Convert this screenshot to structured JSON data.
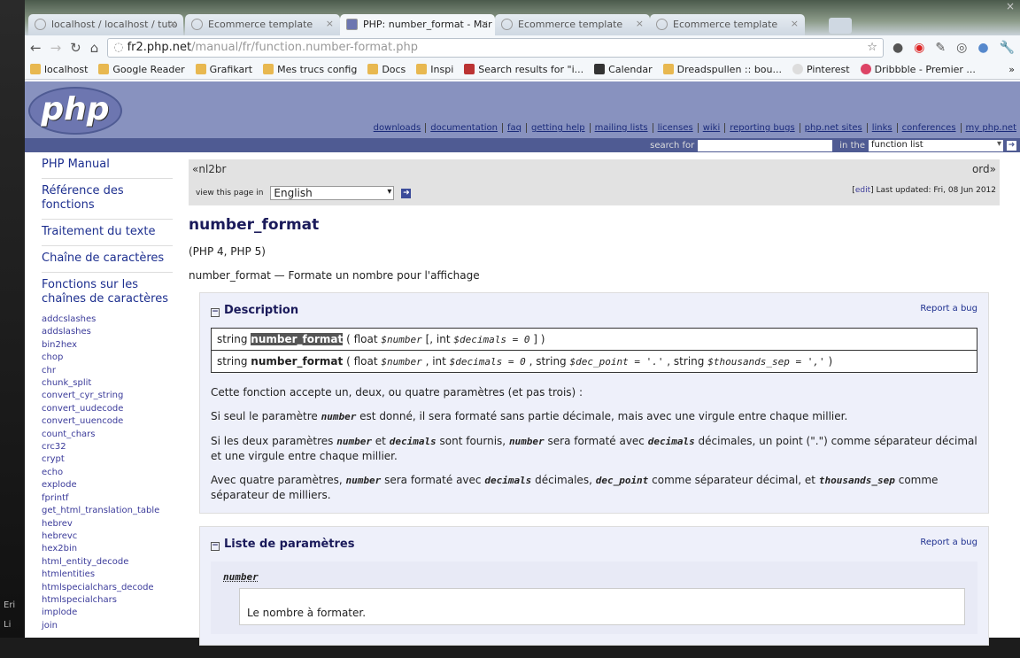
{
  "desktop": {
    "labels": [
      "Eri",
      "Li"
    ]
  },
  "browser": {
    "tabs": [
      {
        "title": "localhost / localhost / tuto"
      },
      {
        "title": "Ecommerce template"
      },
      {
        "title": "PHP: number_format - Mar",
        "active": true
      },
      {
        "title": "Ecommerce template"
      },
      {
        "title": "Ecommerce template"
      }
    ],
    "url_host": "fr2.php.net",
    "url_path": "/manual/fr/function.number-format.php",
    "bookmarks": [
      "localhost",
      "Google Reader",
      "Grafikart",
      "Mes trucs config",
      "Docs",
      "Inspi",
      "Search results for \"i...",
      "Calendar",
      "Dreadspullen :: bou...",
      "Pinterest",
      "Dribbble - Premier ..."
    ],
    "more": "»"
  },
  "header": {
    "logo": "php",
    "nav": [
      "downloads",
      "documentation",
      "faq",
      "getting help",
      "mailing lists",
      "licenses",
      "wiki",
      "reporting bugs",
      "php.net sites",
      "links",
      "conferences",
      "my php.net"
    ],
    "search_label": "search for",
    "search_value": "",
    "in_label": "in the",
    "scope": "function list"
  },
  "sidebar": {
    "sections": [
      "PHP Manual",
      "Référence des fonctions",
      "Traitement du texte",
      "Chaîne de caractères",
      "Fonctions sur les chaînes de caractères"
    ],
    "functions": [
      "addcslashes",
      "addslashes",
      "bin2hex",
      "chop",
      "chr",
      "chunk_split",
      "convert_cyr_string",
      "convert_uudecode",
      "convert_uuencode",
      "count_chars",
      "crc32",
      "crypt",
      "echo",
      "explode",
      "fprintf",
      "get_html_translation_table",
      "hebrev",
      "hebrevc",
      "hex2bin",
      "html_entity_decode",
      "htmlentities",
      "htmlspecialchars_decode",
      "htmlspecialchars",
      "implode",
      "join"
    ]
  },
  "main": {
    "prev": "«nl2br",
    "next": "ord»",
    "view_label": "view this page in",
    "language": "English",
    "edit": "edit",
    "updated": "Last updated: Fri, 08 Jun 2012",
    "title": "number_format",
    "versions": "(PHP 4, PHP 5)",
    "purpose": "number_format — Formate un nombre pour l'affichage",
    "desc": {
      "heading": "Description",
      "report": "Report a bug",
      "sig1": {
        "type": "string",
        "name": "number_format",
        "open": "( float",
        "p1": "$number",
        "mid": "[, int",
        "p2": "$decimals = 0",
        "close": "] )"
      },
      "sig2": {
        "type": "string",
        "name": "number_format",
        "open": "( float",
        "p1": "$number",
        "a": ", int",
        "p2": "$decimals = 0",
        "b": ", string",
        "p3": "$dec_point = '.'",
        "c": ", string",
        "p4": "$thousands_sep = ','",
        "close": ")"
      },
      "p1": "Cette fonction accepte un, deux, ou quatre paramètres (et pas trois) :",
      "p2": [
        "Si seul le paramètre ",
        "number",
        " est donné, il sera formaté sans partie décimale, mais avec une virgule entre chaque millier."
      ],
      "p3": [
        "Si les deux paramètres ",
        "number",
        " et ",
        "decimals",
        " sont fournis, ",
        "number",
        " sera formaté avec ",
        "decimals",
        " décimales, un point (\".\") comme séparateur décimal et une virgule entre chaque millier."
      ],
      "p4": [
        "Avec quatre paramètres, ",
        "number",
        " sera formaté avec ",
        "decimals",
        " décimales, ",
        "dec_point",
        " comme séparateur décimal, et ",
        "thousands_sep",
        " comme séparateur de milliers."
      ]
    },
    "params": {
      "heading": "Liste de paramètres",
      "report": "Report a bug",
      "name": "number",
      "text": "Le nombre à formater."
    }
  }
}
